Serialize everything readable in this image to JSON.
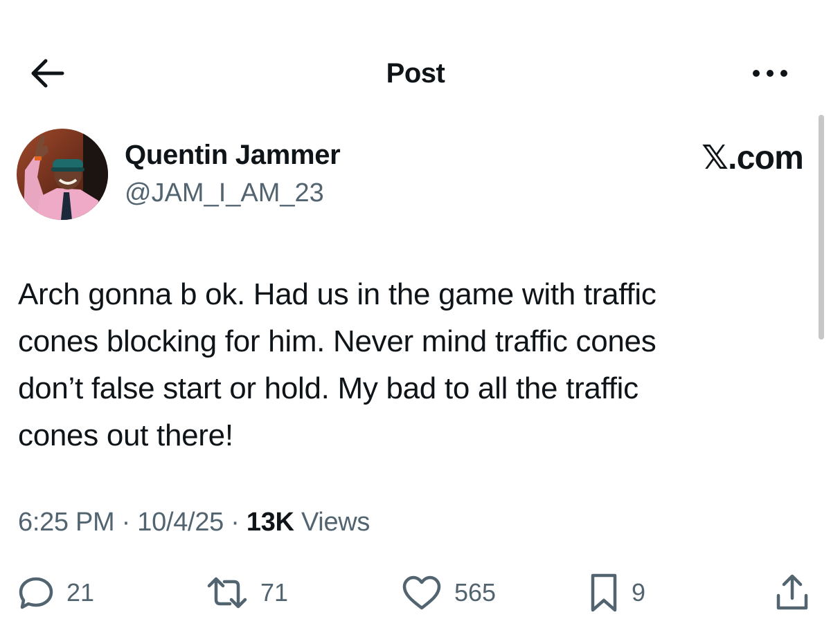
{
  "header": {
    "title": "Post",
    "back_icon": "arrow-left-icon",
    "more_icon": "more-horizontal-icon"
  },
  "author": {
    "name": "Quentin Jammer",
    "handle": "@JAM_I_AM_23"
  },
  "watermark": "𝕏.com",
  "post": {
    "text": "Arch gonna b ok. Had us in the game with traffic\ncones blocking for him.  Never mind traffic cones\ndon’t false start or hold. My bad to all the traffic\ncones out there!",
    "time": "6:25 PM",
    "date": "10/4/25",
    "separator": " · ",
    "views_count": "13K",
    "views_label": "Views"
  },
  "actions": {
    "replies": "21",
    "reposts": "71",
    "likes": "565",
    "bookmarks": "9"
  },
  "colors": {
    "text": "#0f1419",
    "secondary": "#536471",
    "background": "#ffffff"
  }
}
